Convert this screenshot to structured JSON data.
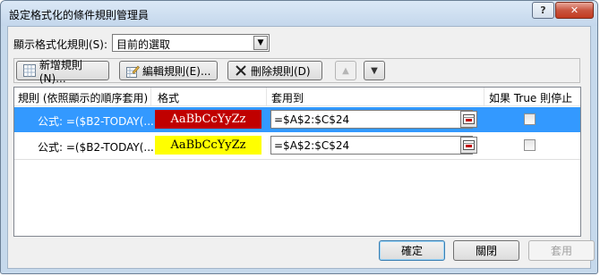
{
  "window": {
    "title": "設定格式化的條件規則管理員"
  },
  "show_rules": {
    "label": "顯示格式化規則(S):",
    "selected": "目前的選取"
  },
  "toolbar": {
    "new_label": "新增規則(N)...",
    "edit_label": "編輯規則(E)...",
    "delete_label": "刪除規則(D)"
  },
  "columns": {
    "rule": "規則 (依照顯示的順序套用)",
    "format": "格式",
    "applies_to": "套用到",
    "stop_if_true": "如果 True 則停止"
  },
  "rules": [
    {
      "formula": "公式: =($B2-TODAY(...",
      "preview": "AaBbCcYyZz",
      "fill": "#c00000",
      "text_color": "#ffffff",
      "applies_to": "=$A$2:$C$24",
      "stop_if_true": false,
      "selected": true
    },
    {
      "formula": "公式: =($B2-TODAY(...",
      "preview": "AaBbCcYyZz",
      "fill": "#ffff00",
      "text_color": "#000000",
      "applies_to": "=$A$2:$C$24",
      "stop_if_true": false,
      "selected": false
    }
  ],
  "buttons": {
    "ok": "確定",
    "close": "關閉",
    "apply": "套用"
  },
  "colors": {
    "selection": "#3399ff",
    "frame": "#c6d9ec"
  }
}
